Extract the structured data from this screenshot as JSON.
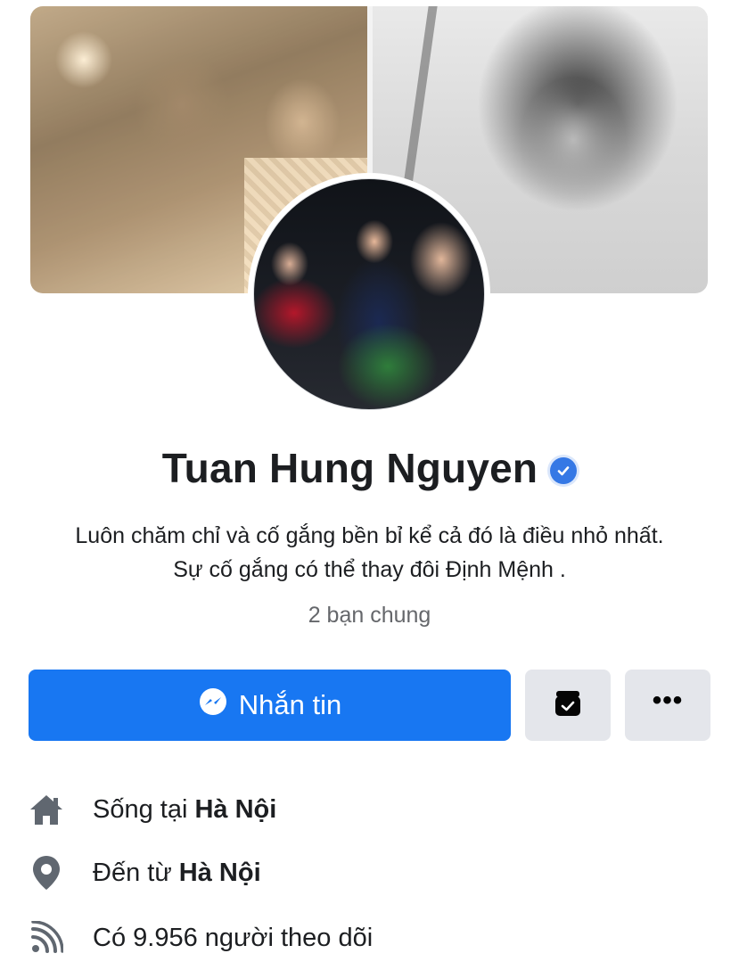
{
  "profile": {
    "name": "Tuan Hung Nguyen",
    "verified": true,
    "bio_line1": "Luôn chăm chỉ và cố gắng bền bỉ kể cả đó là điều nhỏ nhất.",
    "bio_line2": "Sự cố gắng có thể thay đôi Định Mệnh .",
    "mutual_friends": "2 bạn chung"
  },
  "actions": {
    "message_label": "Nhắn tin",
    "message_icon": "messenger-icon",
    "save_icon": "save-icon",
    "more_icon": "more-icon",
    "more_glyph": "•••"
  },
  "info": {
    "lives": {
      "prefix": "Sống tại",
      "place": "Hà Nội",
      "icon": "home-icon"
    },
    "from": {
      "prefix": "Đến từ",
      "place": "Hà Nội",
      "icon": "location-pin-icon"
    },
    "followers": {
      "text": "Có 9.956 người theo dõi",
      "icon": "rss-followers-icon"
    }
  },
  "colors": {
    "primary": "#1877f2",
    "button_gray": "#e4e6eb",
    "text_secondary": "#65676b",
    "icon_gray": "#606770"
  }
}
